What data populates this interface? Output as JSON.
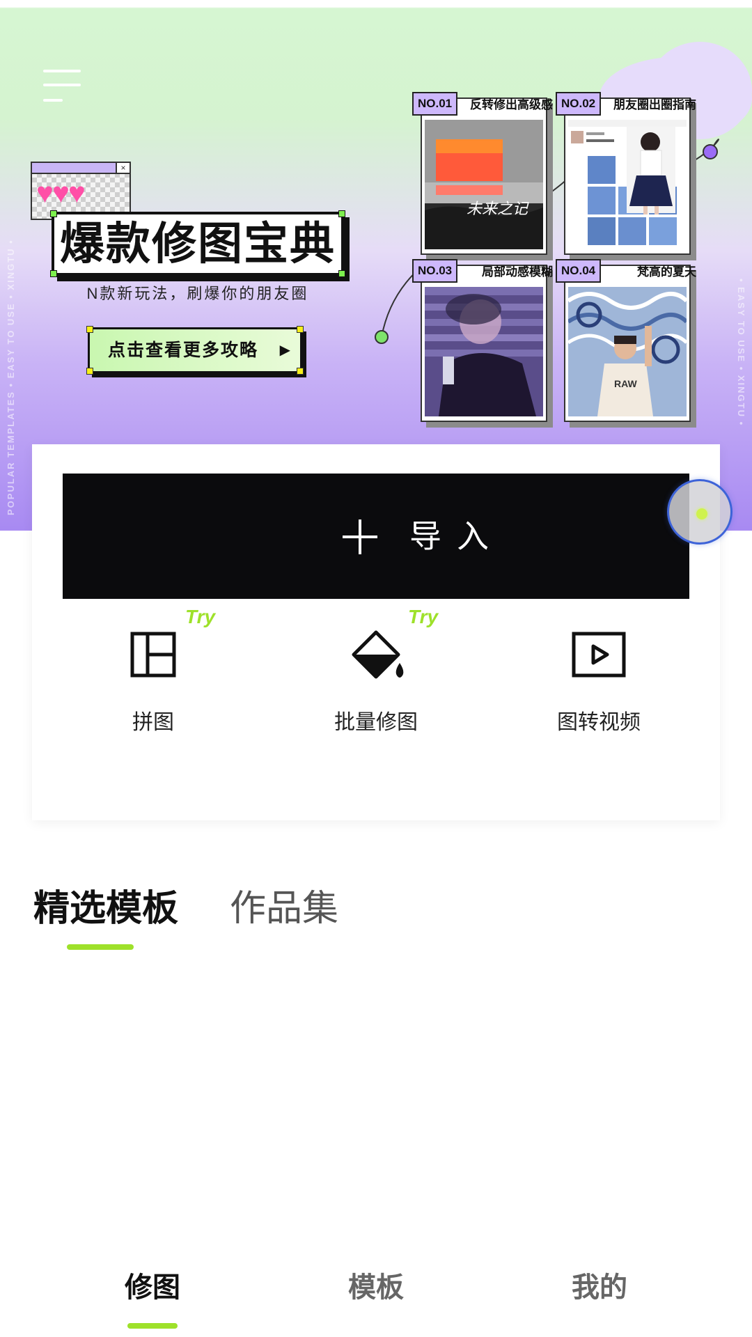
{
  "banner": {
    "title": "爆款修图宝典",
    "subtitle": "N款新玩法，刷爆你的朋友圈",
    "cta_label": "点击查看更多攻略",
    "cta_arrow": "▶",
    "side_text_left": "POPULAR TEMPLATES • EASY TO USE • XINGTU •",
    "side_text_right": "• EASY TO USE • XINGTU •",
    "cards": [
      {
        "tag": "NO.01",
        "title": "反转修出高级感"
      },
      {
        "tag": "NO.02",
        "title": "朋友圈出圈指南"
      },
      {
        "tag": "NO.03",
        "title": "局部动感模糊"
      },
      {
        "tag": "NO.04",
        "title": "梵高的夏天"
      }
    ],
    "colors": {
      "accent_green": "#9ee12a",
      "lavender": "#a88af2",
      "mint": "#d5f3d0"
    }
  },
  "import": {
    "label": "导入",
    "icon": "plus-icon"
  },
  "tools": [
    {
      "label": "拼图",
      "icon": "collage-icon",
      "badge": "Try"
    },
    {
      "label": "批量修图",
      "icon": "paint-bucket-icon",
      "badge": "Try"
    },
    {
      "label": "图转视频",
      "icon": "play-video-icon",
      "badge": ""
    }
  ],
  "tabs": [
    {
      "label": "精选模板",
      "active": true
    },
    {
      "label": "作品集",
      "active": false
    }
  ],
  "bottom_nav": [
    {
      "label": "修图",
      "active": true
    },
    {
      "label": "模板",
      "active": false
    },
    {
      "label": "我的",
      "active": false
    }
  ]
}
